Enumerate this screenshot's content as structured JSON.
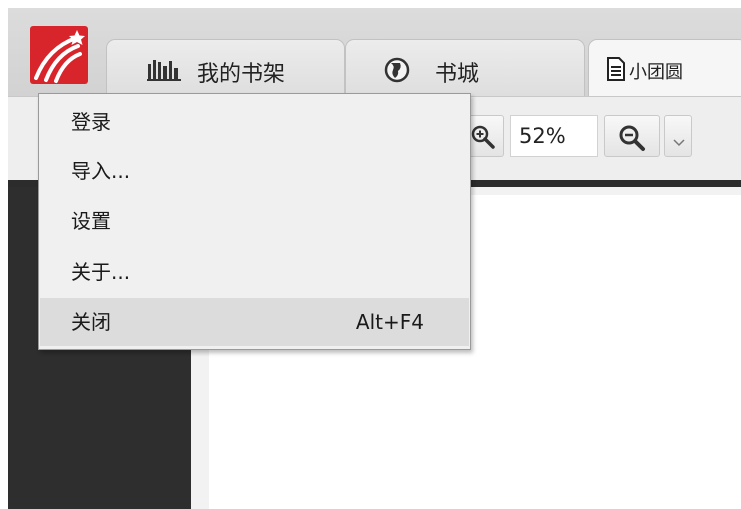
{
  "tabs": [
    {
      "label": "我的书架",
      "icon": "bookshelf-icon"
    },
    {
      "label": "书城",
      "icon": "globe-icon"
    },
    {
      "label": "小团圆",
      "icon": "document-icon"
    }
  ],
  "toolbar": {
    "zoom_value": "52%"
  },
  "menu": {
    "items": [
      {
        "label": "登录",
        "shortcut": ""
      },
      {
        "label": "导入...",
        "shortcut": ""
      },
      {
        "label": "设置",
        "shortcut": ""
      },
      {
        "label": "关于...",
        "shortcut": ""
      },
      {
        "label": "关闭",
        "shortcut": "Alt+F4"
      }
    ]
  },
  "colors": {
    "brand": "#d8252c",
    "sidebar": "#2e2e2e",
    "menu_highlight": "#dcdcdc"
  }
}
